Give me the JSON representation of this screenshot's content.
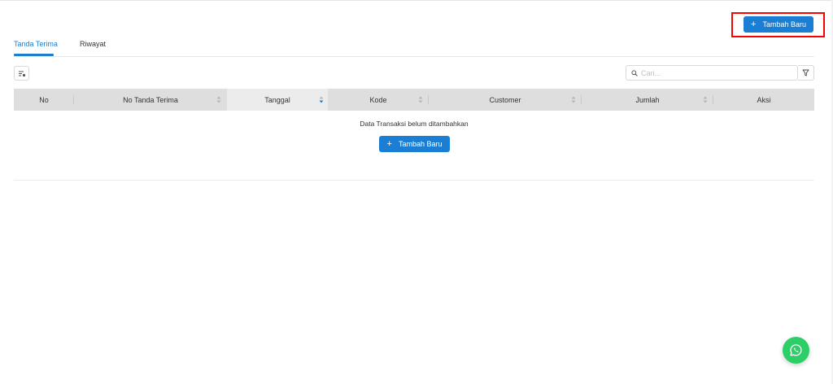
{
  "header": {
    "add_button_label": "Tambah Baru",
    "add_button_icon": "plus-icon"
  },
  "tabs": [
    {
      "label": "Tanda Terima",
      "active": true
    },
    {
      "label": "Riwayat",
      "active": false
    }
  ],
  "toolbar": {
    "settings_icon": "column-settings-icon",
    "search_placeholder": "Cari...",
    "search_value": "",
    "filter_icon": "filter-icon"
  },
  "table": {
    "columns": [
      {
        "label": "No",
        "sortable": false
      },
      {
        "label": "No Tanda Terima",
        "sortable": true
      },
      {
        "label": "Tanggal",
        "sortable": true,
        "sorted": "desc"
      },
      {
        "label": "Kode",
        "sortable": true
      },
      {
        "label": "Customer",
        "sortable": true
      },
      {
        "label": "Jumlah",
        "sortable": true
      },
      {
        "label": "Aksi",
        "sortable": false
      }
    ],
    "rows": [],
    "empty_message": "Data Transaksi belum ditambahkan",
    "empty_button_label": "Tambah Baru"
  },
  "fab": {
    "icon": "whatsapp-icon"
  },
  "colors": {
    "primary": "#1a7fd4",
    "highlight": "#ff0000",
    "whatsapp": "#2ccf67",
    "table_header": "#dedede"
  }
}
